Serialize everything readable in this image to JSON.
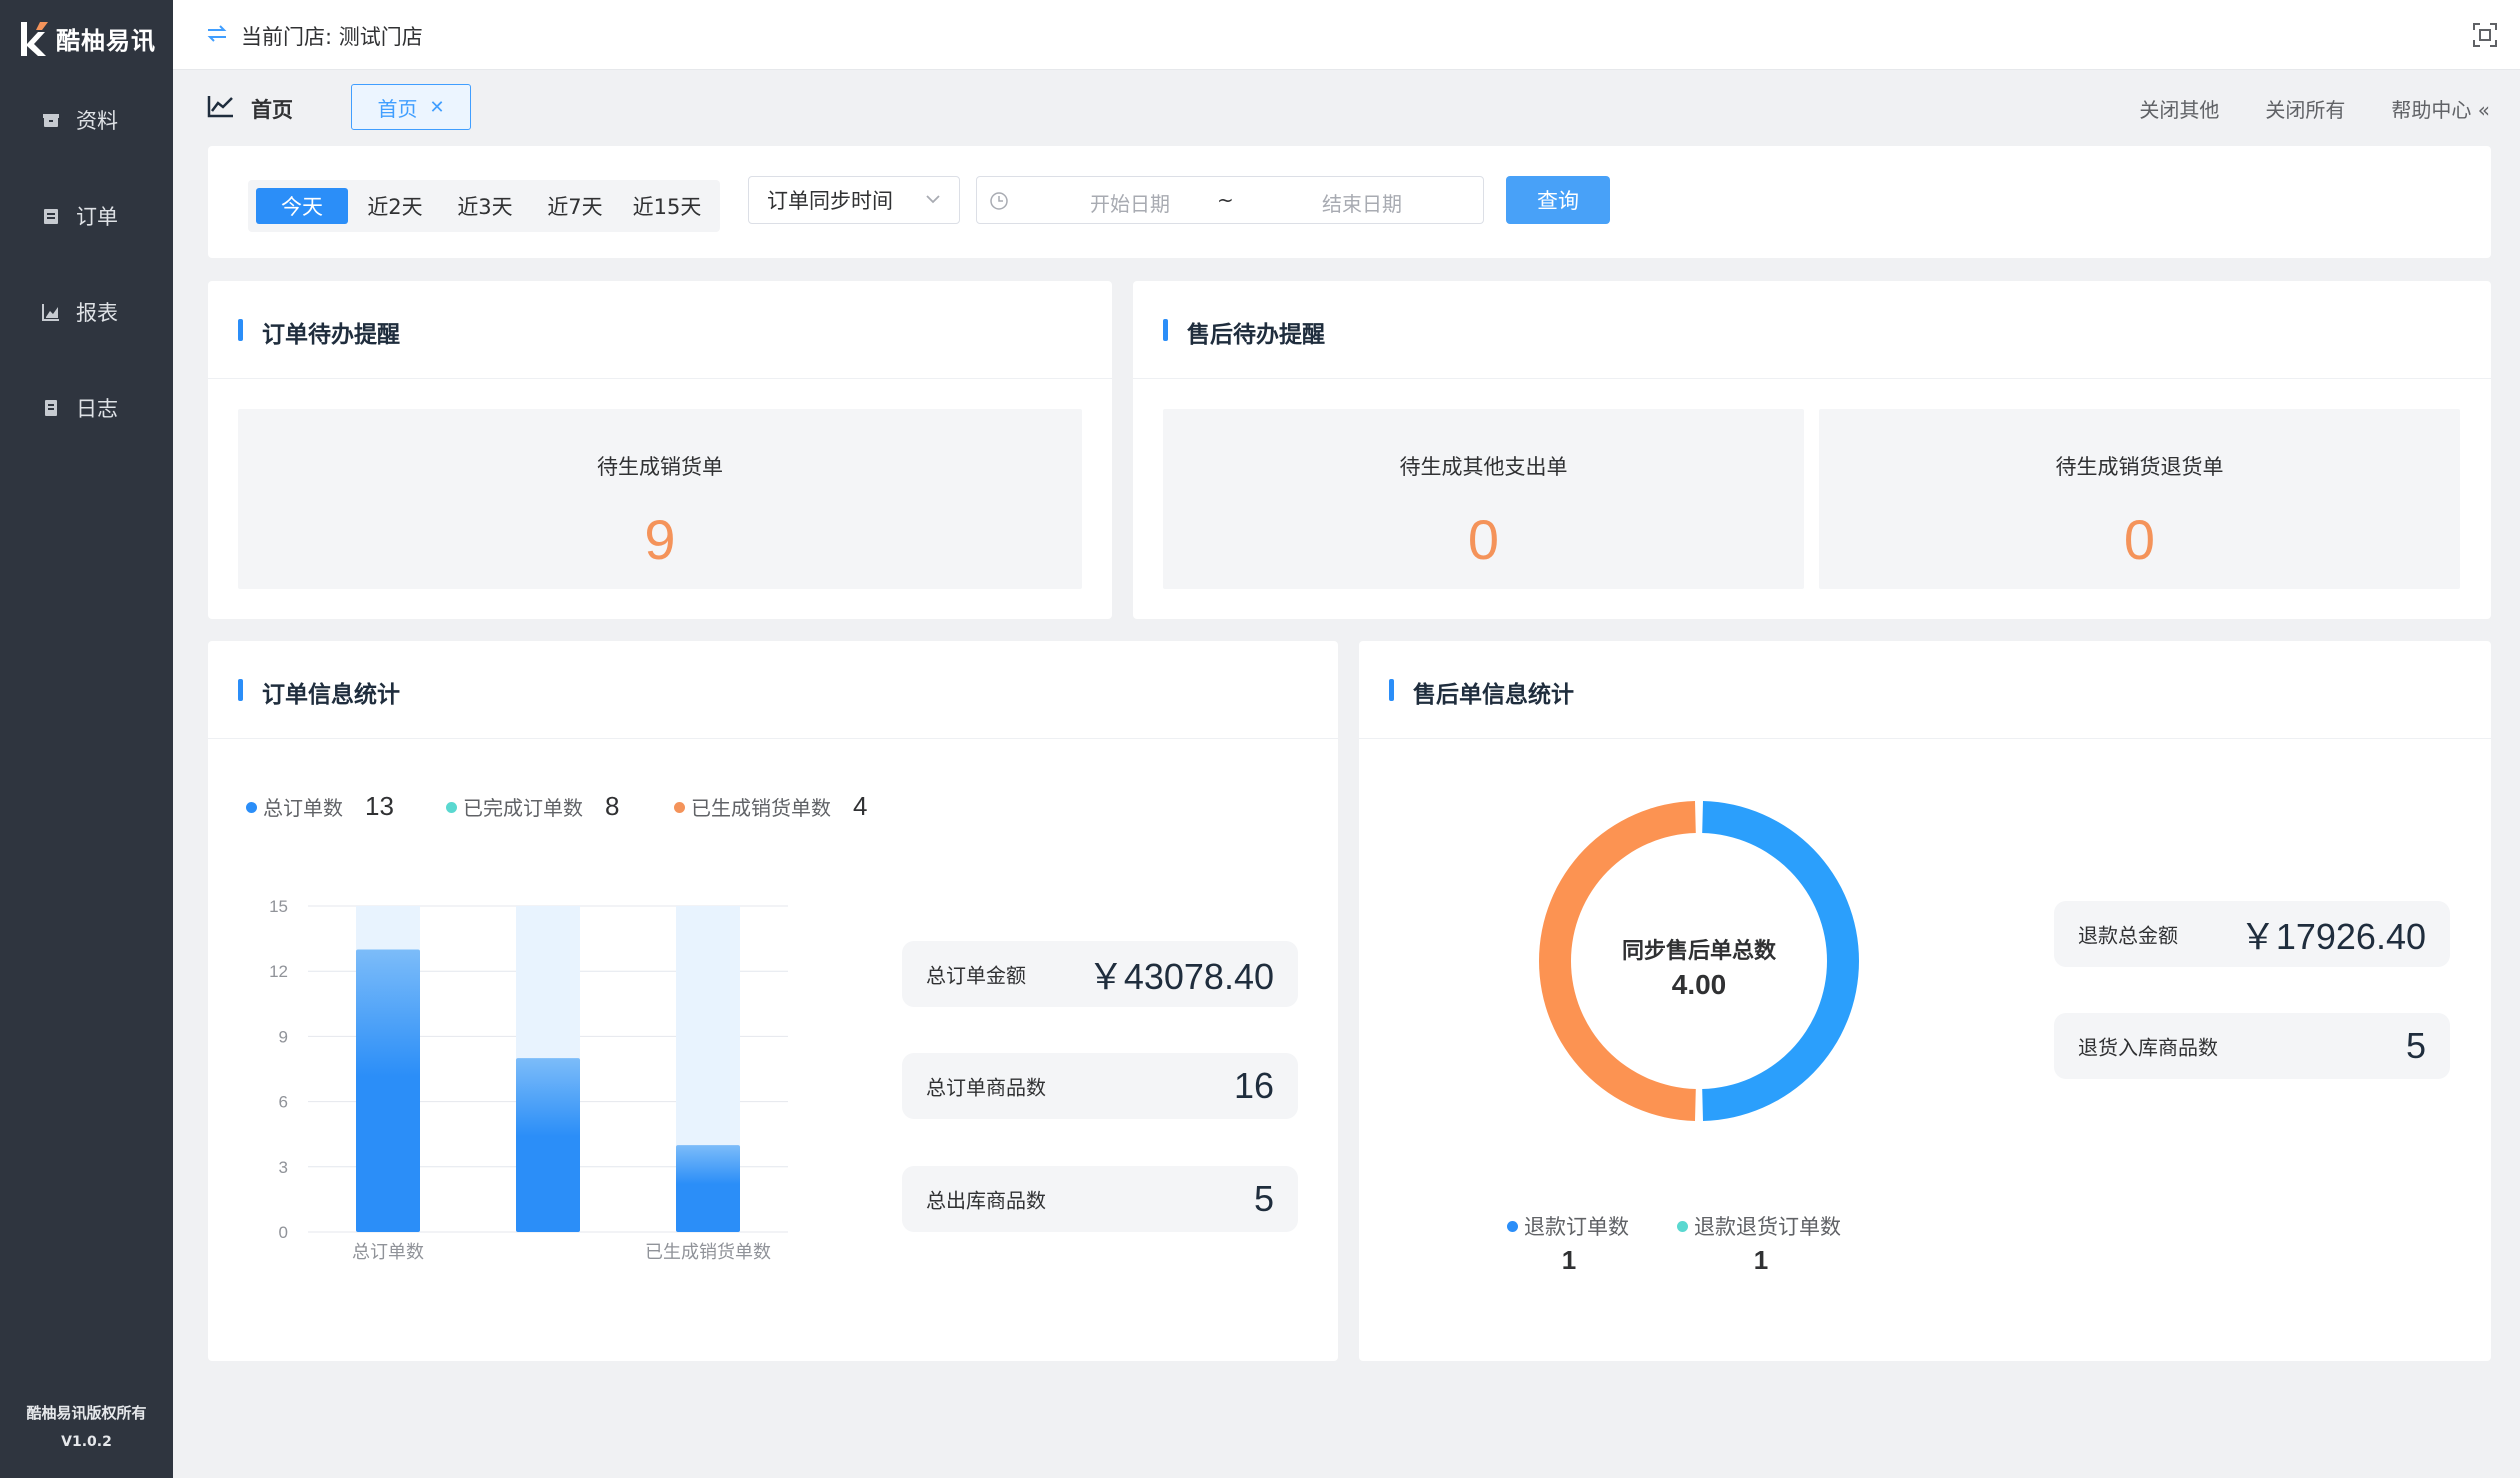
{
  "sidebar": {
    "logo_text": "酷柚易讯",
    "items": [
      {
        "label": "资料",
        "icon": "box-icon"
      },
      {
        "label": "订单",
        "icon": "clipboard-icon"
      },
      {
        "label": "报表",
        "icon": "bar-chart-icon"
      },
      {
        "label": "日志",
        "icon": "document-icon"
      }
    ],
    "copyright": "酷柚易讯版权所有",
    "version": "V1.0.2"
  },
  "topbar": {
    "store_label": "当前门店: 测试门店"
  },
  "tabs": {
    "home_label": "首页",
    "open_tab": "首页",
    "actions": [
      "关闭其他",
      "关闭所有",
      "帮助中心 «"
    ]
  },
  "filter": {
    "quick_ranges": [
      "今天",
      "近2天",
      "近3天",
      "近7天",
      "近15天"
    ],
    "active_range": "今天",
    "select_value": "订单同步时间",
    "start_placeholder": "开始日期",
    "separator": "~",
    "end_placeholder": "结束日期",
    "query_label": "查询"
  },
  "order_todo": {
    "title": "订单待办提醒",
    "tiles": [
      {
        "label": "待生成销货单",
        "value": "9"
      }
    ]
  },
  "aftersale_todo": {
    "title": "售后待办提醒",
    "tiles": [
      {
        "label": "待生成其他支出单",
        "value": "0"
      },
      {
        "label": "待生成销货退货单",
        "value": "0"
      }
    ]
  },
  "order_stats": {
    "title": "订单信息统计",
    "legend": [
      {
        "label": "总订单数",
        "value": "13",
        "color": "#2b8ef8"
      },
      {
        "label": "已完成订单数",
        "value": "8",
        "color": "#5ad8d0"
      },
      {
        "label": "已生成销货单数",
        "value": "4",
        "color": "#f4935a"
      }
    ],
    "pills": [
      {
        "label": "总订单金额",
        "value": "￥43078.40"
      },
      {
        "label": "总订单商品数",
        "value": "16"
      },
      {
        "label": "总出库商品数",
        "value": "5"
      }
    ]
  },
  "aftersale_stats": {
    "title": "售后单信息统计",
    "center_label": "同步售后单总数",
    "center_value": "4.00",
    "legend": [
      {
        "label": "退款订单数",
        "value": "1",
        "color": "#2b8ef8"
      },
      {
        "label": "退款退货订单数",
        "value": "1",
        "color": "#5ad8d0"
      }
    ],
    "pills": [
      {
        "label": "退款总金额",
        "value": "￥17926.40"
      },
      {
        "label": "退货入库商品数",
        "value": "5"
      }
    ]
  },
  "chart_data": [
    {
      "type": "bar",
      "categories": [
        "总订单数",
        "已完成订单数",
        "已生成销货单数"
      ],
      "tick_labels_shown": [
        "总订单数",
        "",
        "已生成销货单数"
      ],
      "values": [
        13,
        8,
        4
      ],
      "ylim": [
        0,
        15
      ],
      "yticks": [
        0,
        3,
        6,
        9,
        12,
        15
      ],
      "grid": true,
      "bar_color": "#2b8ef8",
      "background_bar_color": "#e8f3fe"
    },
    {
      "type": "pie",
      "donut": true,
      "slices": [
        {
          "value": 2,
          "color": "#2b9ffc"
        },
        {
          "value": 2,
          "color": "#fc9352"
        }
      ]
    }
  ]
}
